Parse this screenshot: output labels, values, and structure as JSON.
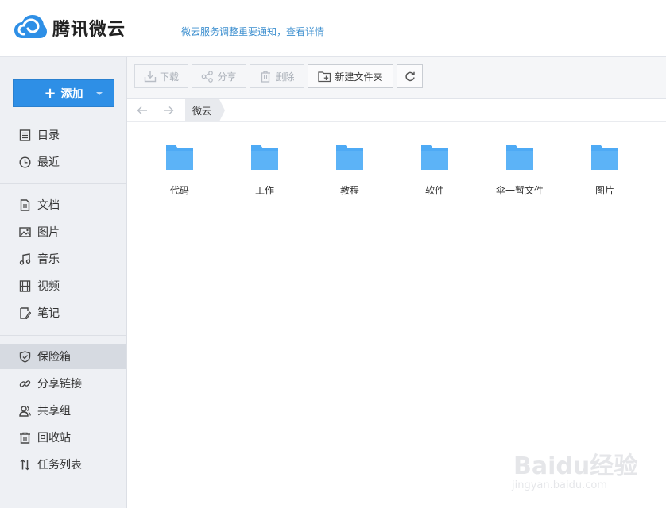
{
  "header": {
    "app_name": "腾讯微云",
    "notice": "微云服务调整重要通知，查看详情"
  },
  "sidebar": {
    "add_label": "添加",
    "group1": [
      {
        "label": "目录",
        "icon": "catalog-icon"
      },
      {
        "label": "最近",
        "icon": "clock-icon"
      }
    ],
    "group2": [
      {
        "label": "文档",
        "icon": "document-icon"
      },
      {
        "label": "图片",
        "icon": "image-icon"
      },
      {
        "label": "音乐",
        "icon": "music-icon"
      },
      {
        "label": "视频",
        "icon": "video-icon"
      },
      {
        "label": "笔记",
        "icon": "note-icon"
      }
    ],
    "group3": [
      {
        "label": "保险箱",
        "icon": "shield-icon",
        "active": true
      },
      {
        "label": "分享链接",
        "icon": "link-icon"
      },
      {
        "label": "共享组",
        "icon": "group-icon"
      },
      {
        "label": "回收站",
        "icon": "trash-icon"
      },
      {
        "label": "任务列表",
        "icon": "transfer-icon"
      }
    ]
  },
  "toolbar": {
    "download": "下载",
    "share": "分享",
    "delete": "删除",
    "new_folder": "新建文件夹"
  },
  "breadcrumb": {
    "current": "微云"
  },
  "folders": [
    {
      "name": "代码"
    },
    {
      "name": "工作"
    },
    {
      "name": "教程"
    },
    {
      "name": "软件"
    },
    {
      "name": "伞一暂文件"
    },
    {
      "name": "图片"
    }
  ],
  "watermark": {
    "text": "Baidu经验",
    "url": "jingyan.baidu.com"
  },
  "colors": {
    "accent": "#2e8fe6",
    "folder": "#4eaaf5",
    "notice": "#3d8fcf",
    "sidebar_bg": "#eef0f4"
  }
}
